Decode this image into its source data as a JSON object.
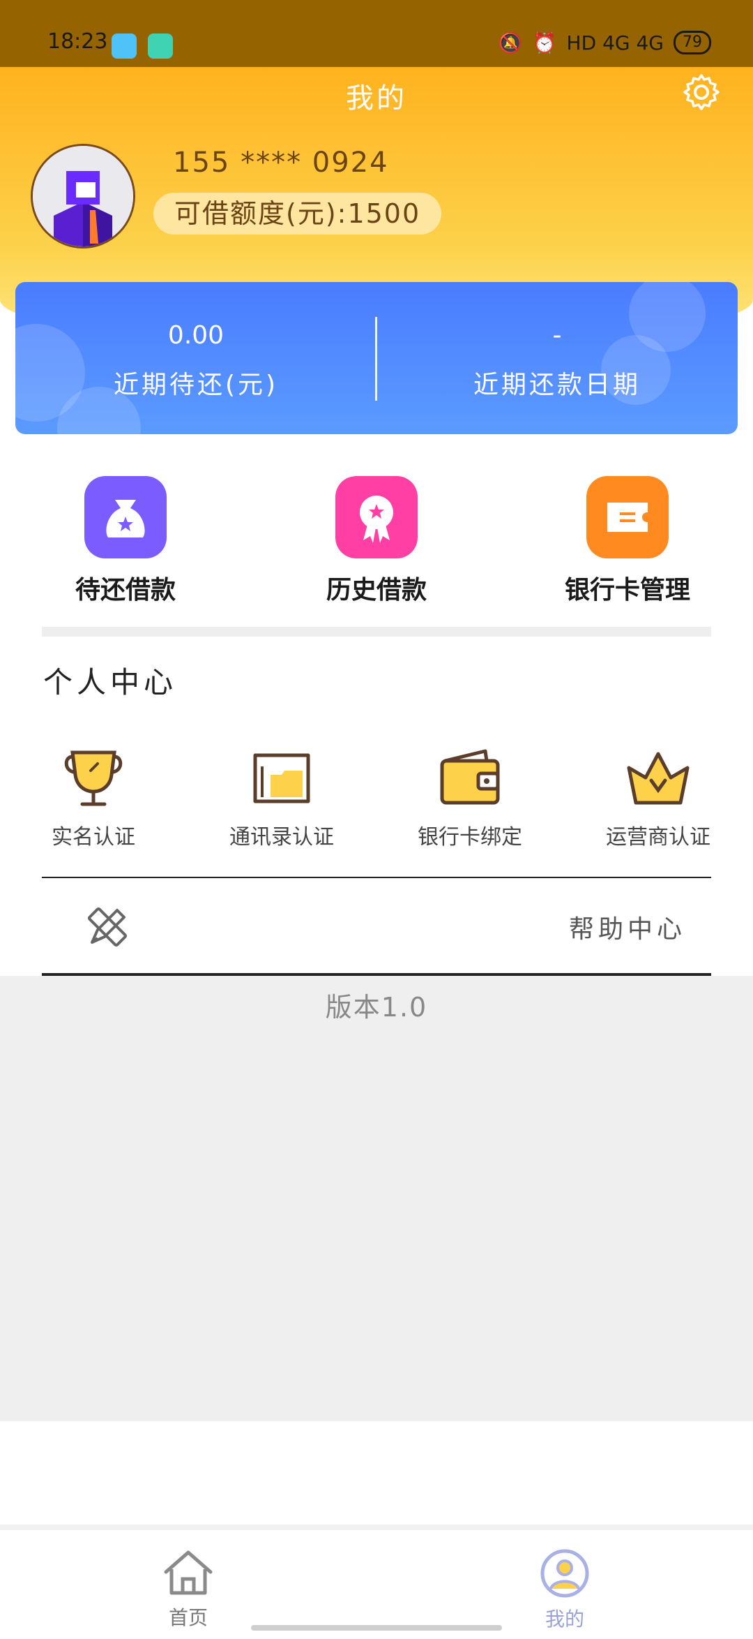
{
  "status_bar": {
    "time": "18:23",
    "network": "HD 4G 4G",
    "battery": "79"
  },
  "header": {
    "title": "我的",
    "phone": "155 **** 0924",
    "quota": "可借额度(元):1500"
  },
  "summary": {
    "due_amount": "0.00",
    "due_label": "近期待还(元)",
    "due_date": "-",
    "due_date_label": "近期还款日期"
  },
  "loan_actions": [
    {
      "label": "待还借款",
      "icon": "money-bag-icon",
      "color": "#7b5cff"
    },
    {
      "label": "历史借款",
      "icon": "award-ribbon-icon",
      "color": "#ff3fa4"
    },
    {
      "label": "银行卡管理",
      "icon": "card-manage-icon",
      "color": "#ff8a1f"
    }
  ],
  "personal_center": {
    "title": "个人中心",
    "items": [
      {
        "label": "实名认证",
        "icon": "trophy-icon"
      },
      {
        "label": "通讯录认证",
        "icon": "folder-icon"
      },
      {
        "label": "银行卡绑定",
        "icon": "wallet-icon"
      },
      {
        "label": "运营商认证",
        "icon": "crown-icon"
      }
    ]
  },
  "help": {
    "label": "帮助中心",
    "icon": "pencil-ruler-icon"
  },
  "version": "版本1.0",
  "tabbar": {
    "items": [
      {
        "label": "首页",
        "icon": "home-icon"
      },
      {
        "label": "我的",
        "icon": "profile-icon"
      }
    ]
  },
  "colors": {
    "accent_yellow": "#fcc02d",
    "card_blue": "#4a7cff",
    "icon_brown": "#5a3d2b",
    "icon_fill": "#fdd24a"
  }
}
